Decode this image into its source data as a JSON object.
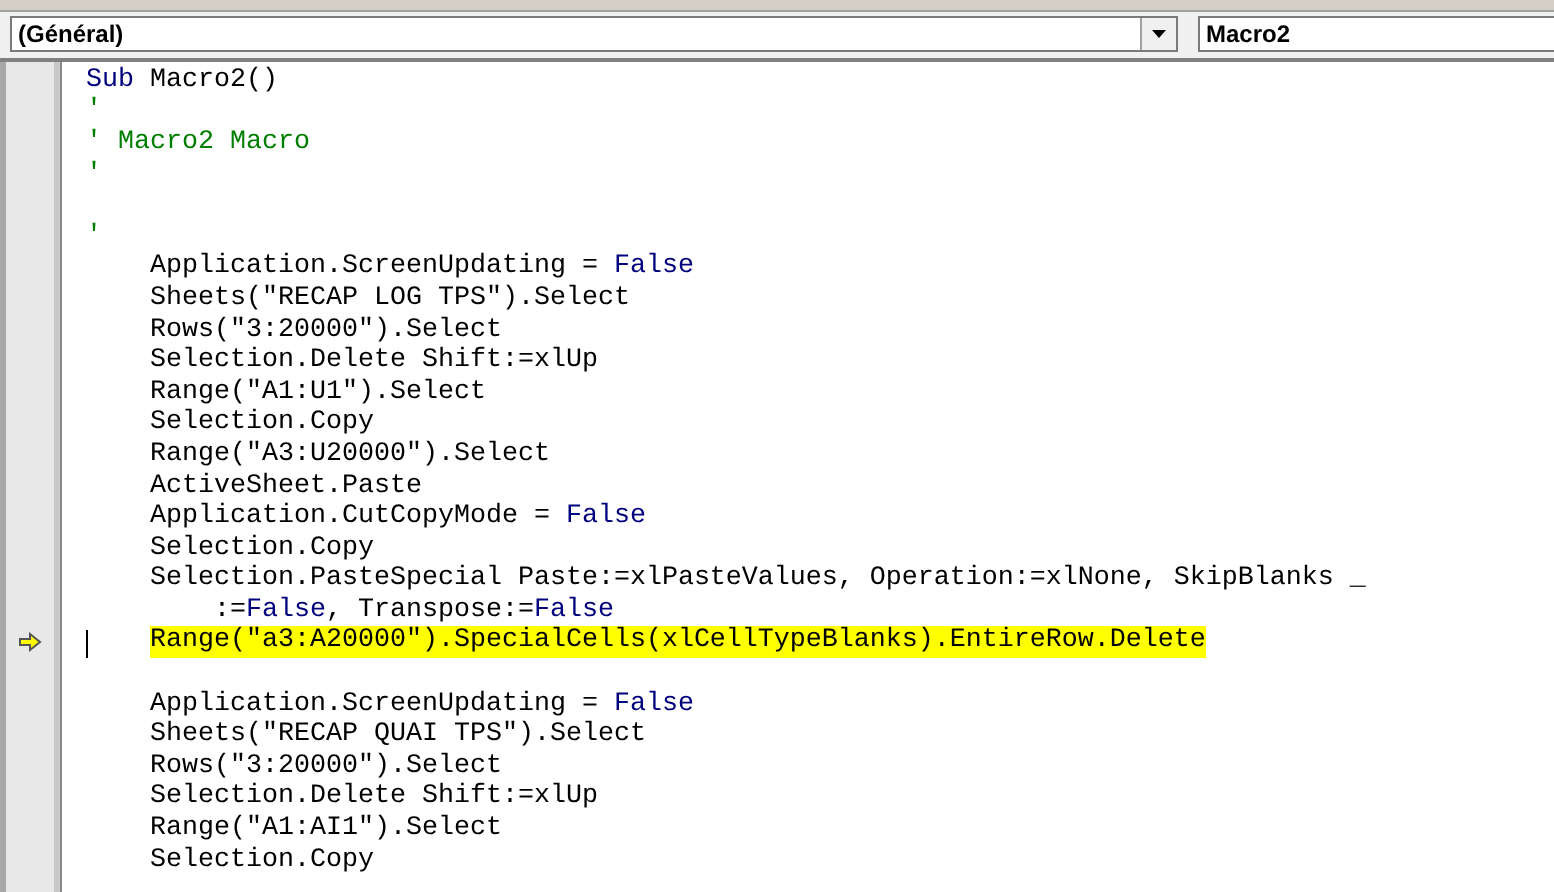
{
  "object_dropdown": {
    "value": "(Général)"
  },
  "procedure_dropdown": {
    "value": "Macro2"
  },
  "code_lines": [
    {
      "kind": "top",
      "tokens": [
        {
          "text": "Sub",
          "kind": "keyword"
        },
        {
          "text": " Macro2()",
          "kind": "plain"
        }
      ]
    },
    {
      "kind": "top",
      "tokens": [
        {
          "text": "'",
          "kind": "comment"
        }
      ]
    },
    {
      "kind": "top",
      "tokens": [
        {
          "text": "' Macro2 Macro",
          "kind": "comment"
        }
      ]
    },
    {
      "kind": "top",
      "tokens": [
        {
          "text": "'",
          "kind": "comment"
        }
      ]
    },
    {
      "kind": "blank"
    },
    {
      "kind": "top",
      "tokens": [
        {
          "text": "'",
          "kind": "comment"
        }
      ]
    },
    {
      "kind": "body",
      "tokens": [
        {
          "text": "Application.ScreenUpdating = ",
          "kind": "plain"
        },
        {
          "text": "False",
          "kind": "keyword"
        }
      ]
    },
    {
      "kind": "body",
      "tokens": [
        {
          "text": "Sheets(\"RECAP LOG TPS\").Select",
          "kind": "plain"
        }
      ]
    },
    {
      "kind": "body",
      "tokens": [
        {
          "text": "Rows(\"3:20000\").Select",
          "kind": "plain"
        }
      ]
    },
    {
      "kind": "body",
      "tokens": [
        {
          "text": "Selection.Delete Shift:=xlUp",
          "kind": "plain"
        }
      ]
    },
    {
      "kind": "body",
      "tokens": [
        {
          "text": "Range(\"A1:U1\").Select",
          "kind": "plain"
        }
      ]
    },
    {
      "kind": "body",
      "tokens": [
        {
          "text": "Selection.Copy",
          "kind": "plain"
        }
      ]
    },
    {
      "kind": "body",
      "tokens": [
        {
          "text": "Range(\"A3:U20000\").Select",
          "kind": "plain"
        }
      ]
    },
    {
      "kind": "body",
      "tokens": [
        {
          "text": "ActiveSheet.Paste",
          "kind": "plain"
        }
      ]
    },
    {
      "kind": "body",
      "tokens": [
        {
          "text": "Application.CutCopyMode = ",
          "kind": "plain"
        },
        {
          "text": "False",
          "kind": "keyword"
        }
      ]
    },
    {
      "kind": "body",
      "tokens": [
        {
          "text": "Selection.Copy",
          "kind": "plain"
        }
      ]
    },
    {
      "kind": "body",
      "tokens": [
        {
          "text": "Selection.PasteSpecial Paste:=xlPasteValues, Operation:=xlNone, SkipBlanks _",
          "kind": "plain"
        }
      ]
    },
    {
      "kind": "continuation",
      "tokens": [
        {
          "text": ":=",
          "kind": "plain"
        },
        {
          "text": "False",
          "kind": "keyword"
        },
        {
          "text": ", Transpose:=",
          "kind": "plain"
        },
        {
          "text": "False",
          "kind": "keyword"
        }
      ]
    },
    {
      "kind": "body",
      "current": true,
      "highlighted": true,
      "caret": true,
      "tokens": [
        {
          "text": "Range(\"a3:A20000\").SpecialCells(xlCellTypeBlanks).EntireRow.Delete",
          "kind": "plain"
        }
      ]
    },
    {
      "kind": "blank"
    },
    {
      "kind": "body",
      "tokens": [
        {
          "text": "Application.ScreenUpdating = ",
          "kind": "plain"
        },
        {
          "text": "False",
          "kind": "keyword"
        }
      ]
    },
    {
      "kind": "body",
      "tokens": [
        {
          "text": "Sheets(\"RECAP QUAI TPS\").Select",
          "kind": "plain"
        }
      ]
    },
    {
      "kind": "body",
      "tokens": [
        {
          "text": "Rows(\"3:20000\").Select",
          "kind": "plain"
        }
      ]
    },
    {
      "kind": "body",
      "tokens": [
        {
          "text": "Selection.Delete Shift:=xlUp",
          "kind": "plain"
        }
      ]
    },
    {
      "kind": "body",
      "tokens": [
        {
          "text": "Range(\"A1:AI1\").Select",
          "kind": "plain"
        }
      ]
    },
    {
      "kind": "body",
      "tokens": [
        {
          "text": "Selection.Copy",
          "kind": "plain"
        }
      ]
    }
  ]
}
